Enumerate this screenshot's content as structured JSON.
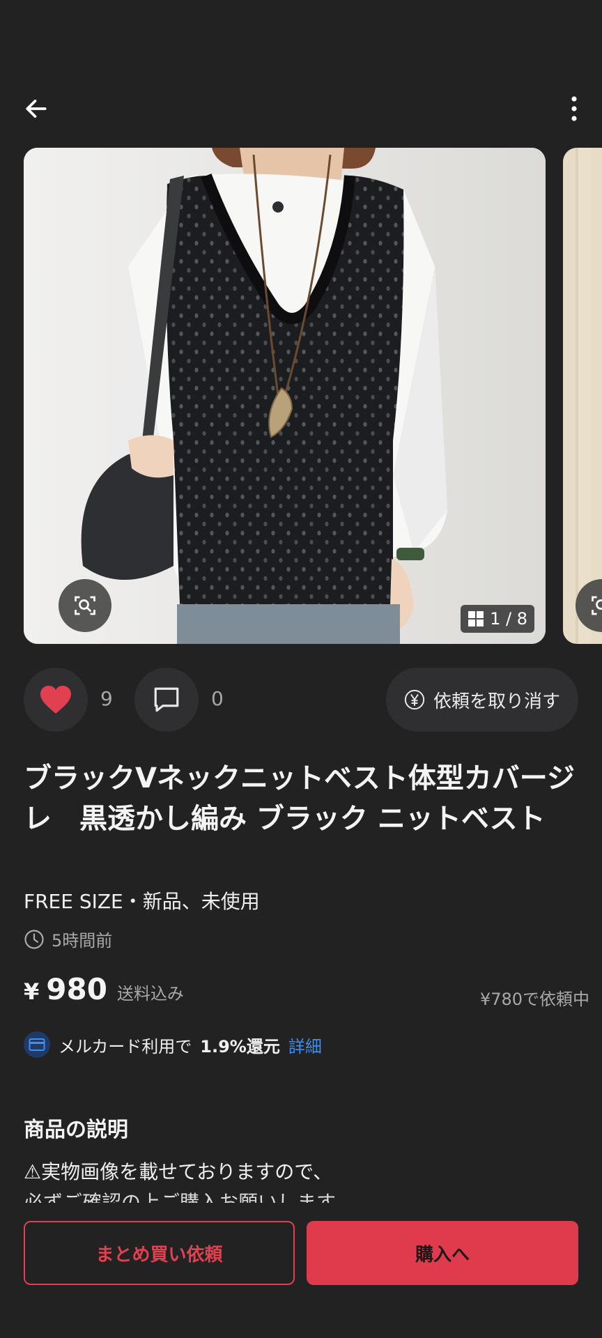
{
  "header": {
    "back_icon": "arrow-left-icon",
    "more_icon": "more-vertical-icon"
  },
  "gallery": {
    "current": "1",
    "total": "8",
    "counter_text": "1 / 8",
    "zoom_icon": "lens-search-icon"
  },
  "actions": {
    "like_count": "9",
    "comment_count": "0",
    "cancel_offer_label": "依頼を取り消す"
  },
  "product": {
    "title": "ブラックVネックニットベスト体型カバージレ　黒透かし編み ブラック ニットベスト",
    "condition": "FREE SIZE・新品、未使用",
    "posted": "5時間前",
    "currency": "¥",
    "price": "980",
    "shipping": "送料込み",
    "offer_status": "¥780で依頼中"
  },
  "merpay": {
    "prefix": "メルカード利用で",
    "rate": "1.9%還元",
    "detail_link": "詳細"
  },
  "description": {
    "heading": "商品の説明",
    "line1": "⚠実物画像を載せておりますので、",
    "line2": "必ずご確認の上ご購入お願いします。"
  },
  "bottom": {
    "bundle_label": "まとめ買い依頼",
    "buy_label": "購入へ"
  },
  "colors": {
    "background": "#222223",
    "accent_red": "#df3b4d",
    "link_blue": "#3d8ff0"
  }
}
